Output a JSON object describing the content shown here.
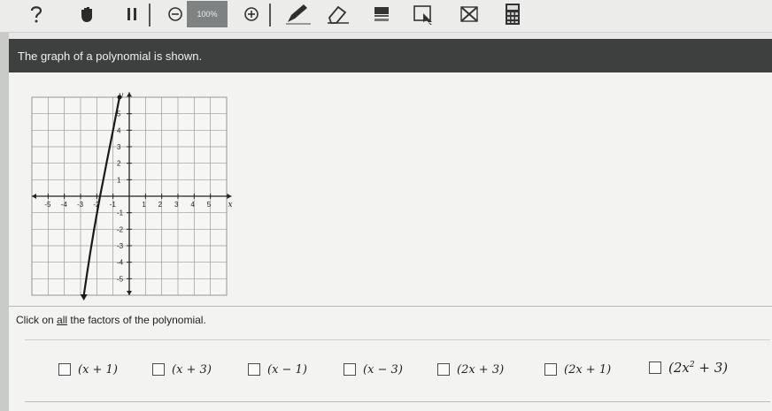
{
  "toolbar": {
    "zoom_label": "100%",
    "icons": [
      "hint-icon",
      "hand-icon",
      "pause-icon",
      "zoom-out-icon",
      "zoom-in-icon",
      "pen-icon",
      "eraser-icon",
      "highlighter-icon",
      "line-reader-icon",
      "eliminator-icon",
      "calculator-icon"
    ]
  },
  "question": {
    "text": "The graph of a polynomial is shown.",
    "prompt_before": "Click on ",
    "prompt_emph": "all",
    "prompt_after": " the factors of the polynomial."
  },
  "chart_data": {
    "type": "line",
    "title": "",
    "xlabel": "x",
    "ylabel": "y",
    "xlim": [
      -6,
      6
    ],
    "ylim": [
      -6,
      6
    ],
    "grid": true,
    "x_ticks": [
      -5,
      -4,
      -3,
      -2,
      -1,
      1,
      2,
      3,
      4,
      5
    ],
    "y_ticks": [
      -5,
      -4,
      -3,
      -2,
      -1,
      1,
      2,
      3,
      4,
      5
    ],
    "x_tick_labels": [
      "-5",
      "-4",
      "-3",
      "-2",
      "-1",
      "1",
      "2",
      "3",
      "4",
      "5"
    ],
    "y_tick_labels": [
      "-5",
      "-4",
      "-3",
      "-2",
      "-1",
      "1",
      "2",
      "3",
      "4",
      "5"
    ],
    "series": [
      {
        "x": [
          -2.8,
          -2.6,
          -2.4,
          -2.2,
          -2.0,
          -1.8,
          -1.6,
          -1.4,
          -1.2,
          -1.0,
          -0.8,
          -0.6
        ],
        "y": [
          -6.0,
          -4.7,
          -3.4,
          -2.2,
          -1.1,
          0.0,
          1.0,
          2.0,
          3.0,
          4.0,
          5.0,
          6.0
        ]
      }
    ]
  },
  "options": [
    {
      "label": "(x + 1)",
      "checked": false
    },
    {
      "label": "(x + 3)",
      "checked": false
    },
    {
      "label": "(x − 1)",
      "checked": false
    },
    {
      "label": "(x − 3)",
      "checked": false
    },
    {
      "label": "(2x + 3)",
      "checked": false
    },
    {
      "label": "(2x + 1)",
      "checked": false
    },
    {
      "label_base": "(2x",
      "label_sup": "2",
      "label_rest": " + 3)",
      "checked": false
    }
  ]
}
